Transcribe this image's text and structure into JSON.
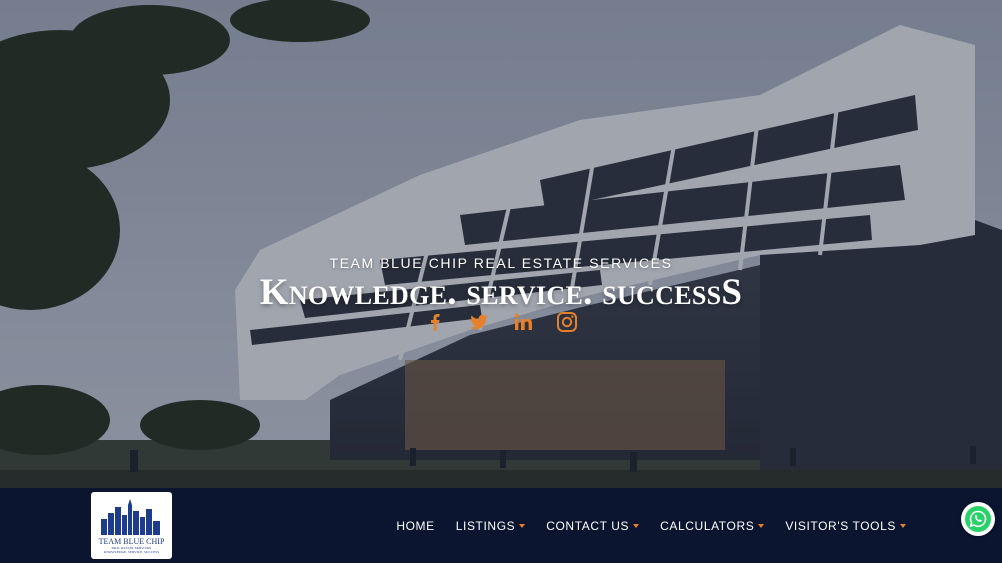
{
  "hero": {
    "kicker": "TEAM BLUE CHIP REAL ESTATE SERVICES",
    "tagline": "Knowledge. service. successS"
  },
  "social": [
    {
      "name": "facebook-icon",
      "color": "#e6802a"
    },
    {
      "name": "twitter-icon",
      "color": "#e6802a"
    },
    {
      "name": "linkedin-icon",
      "color": "#e6802a"
    },
    {
      "name": "instagram-icon",
      "color": "#e6802a"
    }
  ],
  "logo": {
    "name": "TEAM BLUE CHIP",
    "sub": "REAL ESTATE SERVICES",
    "motto": "KNOWLEDGE. SERVICE. SUCCESS"
  },
  "nav": {
    "items": [
      {
        "label": "HOME",
        "dropdown": false
      },
      {
        "label": "LISTINGS",
        "dropdown": true
      },
      {
        "label": "CONTACT US",
        "dropdown": true
      },
      {
        "label": "CALCULATORS",
        "dropdown": true
      },
      {
        "label": "VISITOR'S TOOLS",
        "dropdown": true
      }
    ]
  },
  "colors": {
    "accent": "#e6802a",
    "navbar": "#0b1530",
    "logo_blue": "#1e3c8c",
    "whatsapp": "#25d366"
  },
  "widgets": {
    "chat_icon": "whatsapp-icon"
  }
}
